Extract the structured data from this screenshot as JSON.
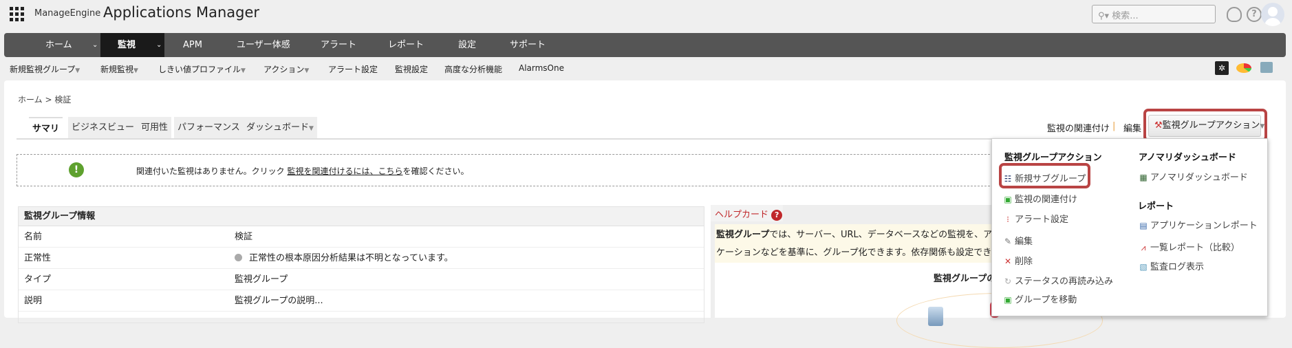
{
  "header": {
    "brand": "ManageEngine",
    "product": "Applications Manager",
    "search_placeholder": "検索..."
  },
  "nav": {
    "items": [
      {
        "label": "ホーム",
        "chevron": true
      },
      {
        "label": "監視",
        "chevron": true,
        "active": true
      },
      {
        "label": "APM"
      },
      {
        "label": "ユーザー体感"
      },
      {
        "label": "アラート"
      },
      {
        "label": "レポート"
      },
      {
        "label": "設定"
      },
      {
        "label": "サポート"
      }
    ]
  },
  "subnav": {
    "items": [
      "新規監視グループ",
      "新規監視",
      "しきい値プロファイル",
      "アクション",
      "アラート設定",
      "監視設定",
      "高度な分析機能",
      "AlarmsOne"
    ]
  },
  "breadcrumb": "ホーム > 検証",
  "tabs": [
    "サマリ",
    "ビジネスビュー",
    "可用性",
    "パフォーマンス",
    "ダッシュボード"
  ],
  "actions": {
    "associate": "監視の関連付け",
    "separator": "|",
    "edit": "編集",
    "group_action": "監視グループアクション"
  },
  "notice": {
    "text": "関連付いた監視はありません。クリック ",
    "link": "監視を関連付けるには、こちら",
    "suffix": "を確認ください。"
  },
  "info": {
    "title": "監視グループ情報",
    "rows": [
      {
        "key": "名前",
        "value": "検証"
      },
      {
        "key": "正常性",
        "value": "正常性の根本原因分析結果は不明となっています。"
      },
      {
        "key": "タイプ",
        "value": "監視グループ"
      },
      {
        "key": "説明",
        "value": "監視グループの説明..."
      }
    ]
  },
  "help": {
    "title": "ヘルプカード",
    "bold": "監視グループ",
    "line1": "では、サーバー、URL、データベースなどの監視を、アプリケ",
    "line2": "ケーションなどを基準に、グループ化できます。依存関係も設定でき、強力",
    "diagram_title": "監視グループの"
  },
  "menu": {
    "col1_title": "監視グループアクション",
    "col1": [
      "新規サブグループ",
      "監視の関連付け",
      "アラート設定",
      "編集",
      "削除",
      "ステータスの再読み込み",
      "グループを移動"
    ],
    "col2_title": "アノマリダッシュボード",
    "col2": [
      "アノマリダッシュボード"
    ],
    "col3_title": "レポート",
    "col3": [
      "アプリケーションレポート",
      "一覧レポート（比較）",
      "監査ログ表示"
    ]
  }
}
